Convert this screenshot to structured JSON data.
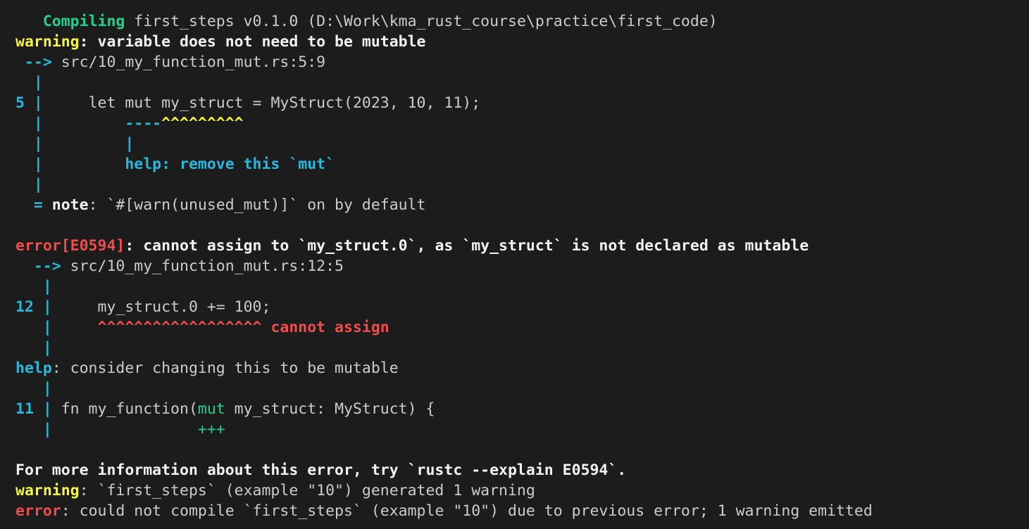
{
  "terminal": {
    "lines": [
      [
        {
          "t": "   ",
          "s": "w"
        },
        {
          "t": "Compiling",
          "s": "gb"
        },
        {
          "t": " first_steps v0.1.0 (D:\\Work\\kma_rust_course\\practice\\first_code)",
          "s": "w"
        }
      ],
      [
        {
          "t": "warning",
          "s": "yb"
        },
        {
          "t": ": variable does not need to be mutable",
          "s": "bw"
        }
      ],
      [
        {
          "t": " --> ",
          "s": "cb"
        },
        {
          "t": "src/10_my_function_mut.rs:5:9",
          "s": "w"
        }
      ],
      [
        {
          "t": "  |",
          "s": "cb"
        }
      ],
      [
        {
          "t": "5 |",
          "s": "cb"
        },
        {
          "t": "     let mut my_struct = MyStruct(2023, 10, 11);",
          "s": "w"
        }
      ],
      [
        {
          "t": "  |         ----",
          "s": "cb"
        },
        {
          "t": "^^^^^^^^^",
          "s": "yb"
        }
      ],
      [
        {
          "t": "  |         |",
          "s": "cb"
        }
      ],
      [
        {
          "t": "  |         help: remove this `mut`",
          "s": "cb"
        }
      ],
      [
        {
          "t": "  |",
          "s": "cb"
        }
      ],
      [
        {
          "t": "  = ",
          "s": "cb"
        },
        {
          "t": "note",
          "s": "bw"
        },
        {
          "t": ": `#[warn(unused_mut)]` on by default",
          "s": "w"
        }
      ],
      [
        {
          "t": "",
          "s": "w"
        }
      ],
      [
        {
          "t": "error[E0594]",
          "s": "rb"
        },
        {
          "t": ": cannot assign to `my_struct.0`, as `my_struct` is not declared as mutable",
          "s": "bw"
        }
      ],
      [
        {
          "t": "  --> ",
          "s": "cb"
        },
        {
          "t": "src/10_my_function_mut.rs:12:5",
          "s": "w"
        }
      ],
      [
        {
          "t": "   |",
          "s": "cb"
        }
      ],
      [
        {
          "t": "12 |",
          "s": "cb"
        },
        {
          "t": "     my_struct.0 += 100;",
          "s": "w"
        }
      ],
      [
        {
          "t": "   |",
          "s": "cb"
        },
        {
          "t": "     ^^^^^^^^^^^^^^^^^^ cannot assign",
          "s": "rb"
        }
      ],
      [
        {
          "t": "   |",
          "s": "cb"
        }
      ],
      [
        {
          "t": "help",
          "s": "cb"
        },
        {
          "t": ": consider changing this to be mutable",
          "s": "w"
        }
      ],
      [
        {
          "t": "   |",
          "s": "cb"
        }
      ],
      [
        {
          "t": "11 |",
          "s": "cb"
        },
        {
          "t": " fn my_function(",
          "s": "w"
        },
        {
          "t": "mut",
          "s": "g"
        },
        {
          "t": " my_struct: MyStruct) {",
          "s": "w"
        }
      ],
      [
        {
          "t": "   |",
          "s": "cb"
        },
        {
          "t": "                ",
          "s": "w"
        },
        {
          "t": "+++",
          "s": "g"
        }
      ],
      [
        {
          "t": "",
          "s": "w"
        }
      ],
      [
        {
          "t": "For more information about this error, try `rustc --explain E0594`.",
          "s": "bw"
        }
      ],
      [
        {
          "t": "warning",
          "s": "yb"
        },
        {
          "t": ": `first_steps` (example \"10\") generated 1 warning",
          "s": "w"
        }
      ],
      [
        {
          "t": "error",
          "s": "rb"
        },
        {
          "t": ": could not compile `first_steps` (example \"10\") due to previous error; 1 warning emitted",
          "s": "w"
        }
      ]
    ]
  },
  "colors": {
    "background": "#1c1c1c",
    "text": "#cccccc",
    "green": "#23d18b",
    "yellow": "#f5f543",
    "cyan": "#29b8db",
    "red": "#f14c4c"
  }
}
